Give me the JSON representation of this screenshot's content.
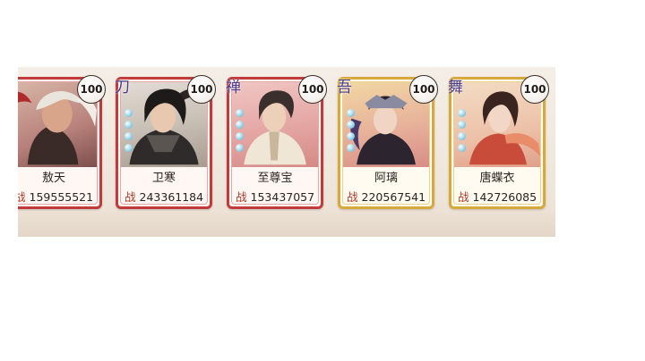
{
  "heroes": [
    {
      "name": "敖天",
      "power_label": "战",
      "power": "159555521",
      "level": "100",
      "class_icon": "",
      "frame": "red"
    },
    {
      "name": "卫寒",
      "power_label": "战",
      "power": "243361184",
      "level": "100",
      "class_icon": "刀",
      "frame": "red"
    },
    {
      "name": "至尊宝",
      "power_label": "战",
      "power": "153437057",
      "level": "100",
      "class_icon": "禅",
      "frame": "red"
    },
    {
      "name": "阿璃",
      "power_label": "战",
      "power": "220567541",
      "level": "100",
      "class_icon": "",
      "frame": "gold"
    },
    {
      "name": "唐蝶衣",
      "power_label": "战",
      "power": "142726085",
      "level": "100",
      "class_icon": "舞",
      "frame": "gold"
    }
  ],
  "colors": {
    "red_frame": "#c23a3a",
    "gold_frame": "#d6a93a",
    "power_label": "#b23a2a",
    "class_icon": "#4a3a8a"
  }
}
